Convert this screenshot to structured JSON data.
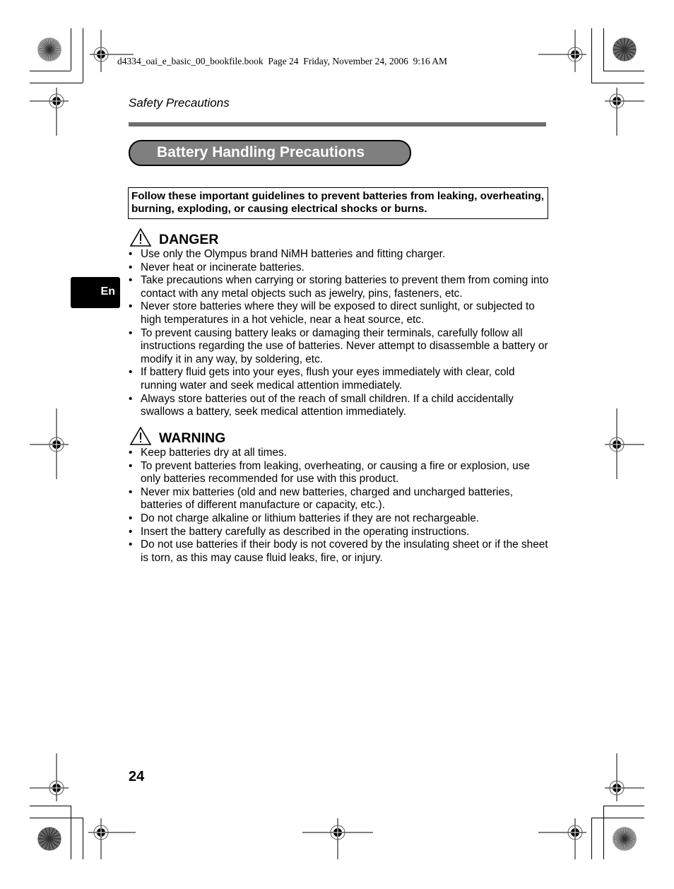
{
  "file_header": "d4334_oai_e_basic_00_bookfile.book  Page 24  Friday, November 24, 2006  9:16 AM",
  "running_head": "Safety Precautions",
  "title": "Battery Handling Precautions",
  "intro": "Follow these important guidelines to prevent batteries from leaking, overheating, burning, exploding, or causing electrical shocks or burns.",
  "language_tab": "En",
  "page_number": "24",
  "bullet_glyph": "•",
  "icons": {
    "section_icon": "warning-triangle-icon",
    "registration_mark": "crosshair-registration-icon",
    "color_target": "starburst-target-icon"
  },
  "colors": {
    "rule": "#6e6e6e",
    "title_fill": "#7f7f7f",
    "tab_fill": "#000000"
  },
  "danger": {
    "heading": "DANGER",
    "items": [
      "Use only the Olympus brand NiMH batteries and fitting charger.",
      "Never heat or incinerate batteries.",
      "Take precautions when carrying or storing batteries to prevent them from coming into contact with any metal objects such as jewelry, pins, fasteners, etc.",
      "Never store batteries where they will be exposed to direct sunlight, or subjected to high temperatures in a hot vehicle, near a heat source, etc.",
      "To prevent causing battery leaks or damaging their terminals, carefully follow all instructions regarding the use of batteries. Never attempt to disassemble a battery or modify it in any way, by soldering, etc.",
      "If battery fluid gets into your eyes, flush your eyes immediately with clear, cold running water and seek medical attention immediately.",
      "Always store batteries out of the reach of small children. If a child accidentally swallows a battery, seek medical attention immediately."
    ]
  },
  "warning": {
    "heading": "WARNING",
    "items": [
      "Keep batteries dry at all times.",
      "To prevent batteries from leaking, overheating, or causing a fire or explosion, use only batteries recommended for use with this product.",
      "Never mix batteries (old and new batteries, charged and uncharged batteries, batteries of different manufacture or capacity, etc.).",
      "Do not charge alkaline or lithium batteries if they are not rechargeable.",
      "Insert the battery carefully as described in the operating instructions.",
      "Do not use batteries if their body is not covered by the insulating sheet or if the sheet is torn, as this may cause fluid leaks, fire, or injury."
    ]
  }
}
